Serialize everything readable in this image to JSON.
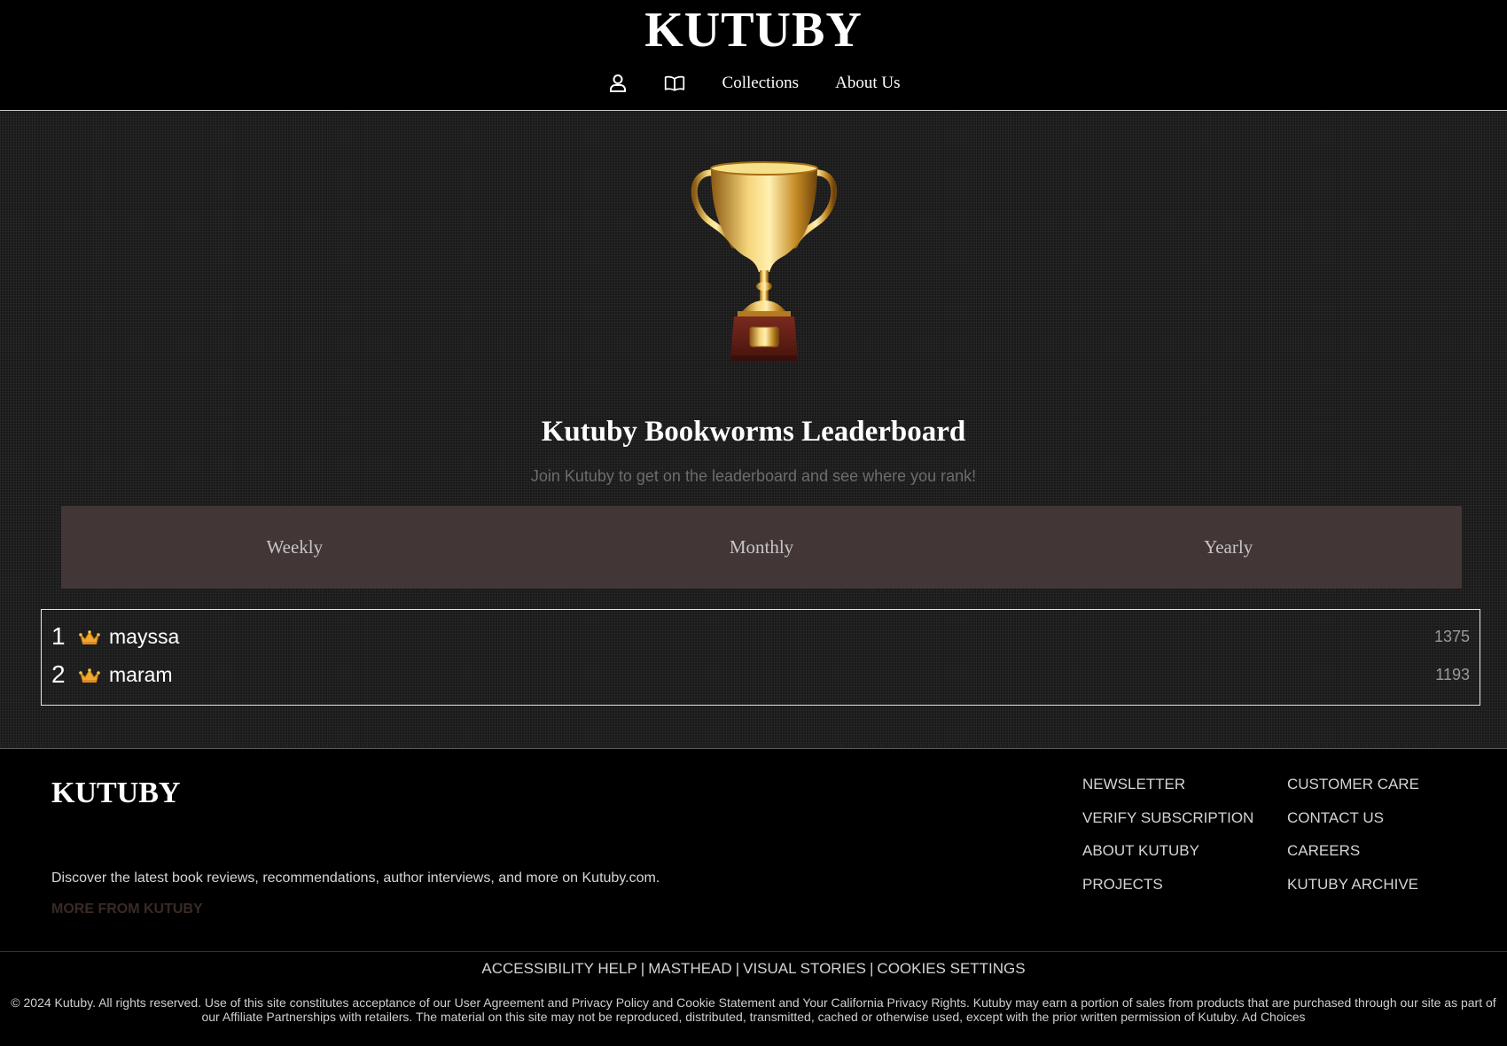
{
  "header": {
    "brand": "KUTUBY",
    "nav": {
      "user_icon": "user-icon",
      "book_icon": "book-icon",
      "collections": "Collections",
      "about": "About Us"
    }
  },
  "leaderboard": {
    "title": "Kutuby Bookworms Leaderboard",
    "subtitle": "Join Kutuby to get on the leaderboard and see where you rank!",
    "tabs": [
      "Weekly",
      "Monthly",
      "Yearly"
    ],
    "entries": [
      {
        "rank": "1",
        "name": "mayssa",
        "score": "1375",
        "icon": "crown-icon"
      },
      {
        "rank": "2",
        "name": "maram",
        "score": "1193",
        "icon": "crown-icon"
      }
    ]
  },
  "footer": {
    "brand": "KUTUBY",
    "description": "Discover the latest book reviews, recommendations, author interviews, and more on Kutuby.com.",
    "more": "MORE FROM KUTUBY",
    "col1": [
      "NEWSLETTER",
      "VERIFY SUBSCRIPTION",
      "ABOUT KUTUBY",
      "PROJECTS"
    ],
    "col2": [
      "CUSTOMER CARE",
      "CONTACT US",
      "CAREERS",
      "KUTUBY ARCHIVE"
    ],
    "bottom_links": [
      "ACCESSIBILITY HELP",
      "MASTHEAD",
      "VISUAL STORIES",
      "COOKIES SETTINGS"
    ],
    "copyright": "© 2024 Kutuby. All rights reserved. Use of this site constitutes acceptance of our User Agreement and Privacy Policy and Cookie Statement and Your California Privacy Rights. Kutuby may earn a portion of sales from products that are purchased through our site as part of our Affiliate Partnerships with retailers. The material on this site may not be reproduced, distributed, transmitted, cached or otherwise used, except with the prior written permission of Kutuby. Ad Choices"
  },
  "colors": {
    "background": "#000000",
    "tab_bar": "#433636",
    "muted_link": "#3a2a25"
  }
}
